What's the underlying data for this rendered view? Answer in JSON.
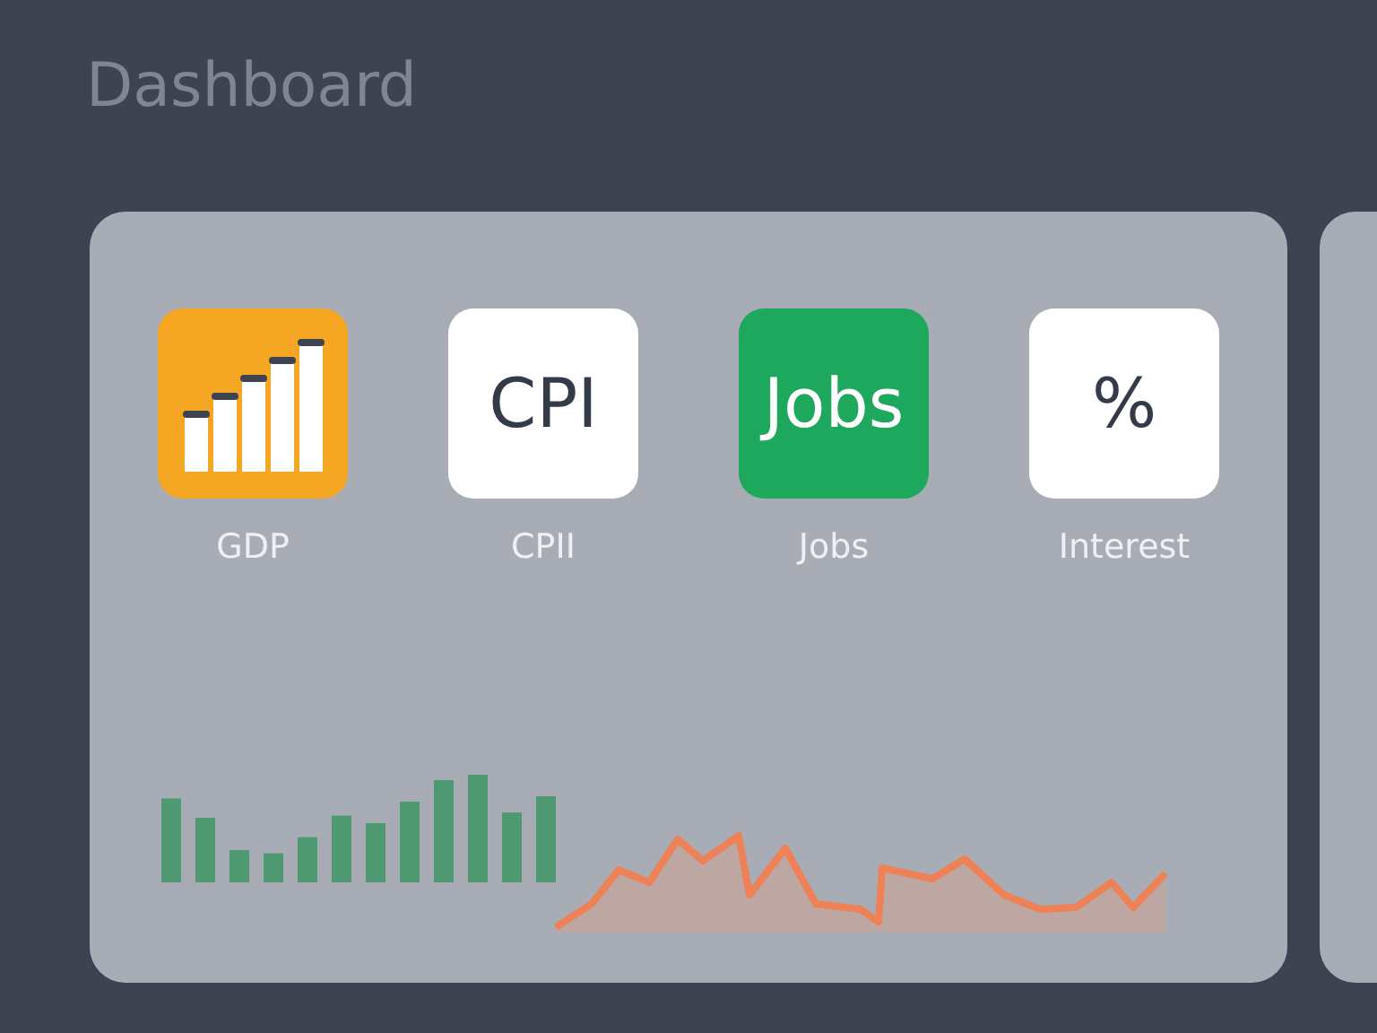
{
  "header": {
    "title": "Dashboard"
  },
  "tiles": [
    {
      "kind": "bars",
      "color": "#f5a623",
      "label": "GDP"
    },
    {
      "kind": "text",
      "color": "#ffffff",
      "glyph": "CPI",
      "label": "CPII"
    },
    {
      "kind": "text",
      "color": "#1ea85e",
      "glyph": "Jobs",
      "label": "Jobs"
    },
    {
      "kind": "text",
      "color": "#ffffff",
      "glyph": "%",
      "label": "Interest"
    }
  ]
}
